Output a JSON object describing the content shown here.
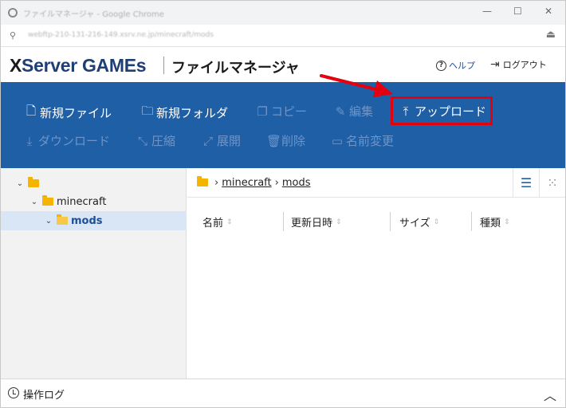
{
  "window": {
    "title": "ファイルマネージャ - Google Chrome",
    "url": "webftp-210-131-216-149.xsrv.ne.jp/minecraft/mods",
    "icons": {
      "app": "chrome-icon",
      "minimize": "minimize-icon",
      "maximize": "maximize-icon",
      "close": "close-icon",
      "address": "tune-icon",
      "share": "share-icon"
    }
  },
  "header": {
    "logo_prefix": "X",
    "logo_rest": "Server GAMEs",
    "app_title": "ファイルマネージャ",
    "help_label": "ヘルプ",
    "logout_label": "ログアウト"
  },
  "toolbar": {
    "new_file": "新規ファイル",
    "new_folder": "新規フォルダ",
    "copy": "コピー",
    "edit": "編集",
    "upload": "アップロード",
    "download": "ダウンロード",
    "compress": "圧縮",
    "extract": "展開",
    "delete": "削除",
    "rename": "名前変更"
  },
  "tree": {
    "root_label": "",
    "items": [
      {
        "label": "minecraft"
      },
      {
        "label": "mods"
      }
    ]
  },
  "path": {
    "segments": [
      "minecraft",
      "mods"
    ]
  },
  "columns": {
    "name": "名前",
    "modified": "更新日時",
    "size": "サイズ",
    "type": "種類"
  },
  "log": {
    "label": "操作ログ"
  },
  "colors": {
    "toolbar_bg": "#1f5fa6",
    "highlight": "#e3000f",
    "folder": "#f4b400",
    "selected_row": "#d8e6f5"
  }
}
